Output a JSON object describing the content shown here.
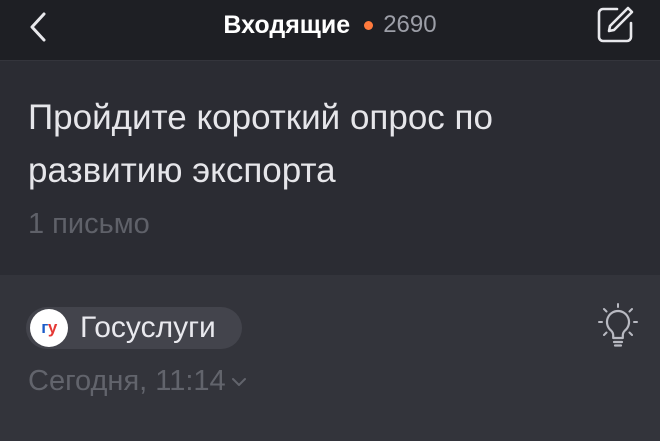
{
  "nav": {
    "back_icon": "chevron-left-icon",
    "title": "Входящие",
    "unread_count": "2690",
    "unread_dot_color": "#ff7a3d",
    "compose_icon": "compose-icon"
  },
  "thread": {
    "subject": "Пройдите короткий опрос по развитию экспорта",
    "message_count": "1 письмо"
  },
  "message": {
    "sender_avatar_text_part1": "г",
    "sender_avatar_text_part2": "у",
    "sender_name": "Госуслуги",
    "date": "Сегодня, 11:14",
    "date_expand_icon": "chevron-down-icon",
    "tip_icon": "lightbulb-icon"
  }
}
